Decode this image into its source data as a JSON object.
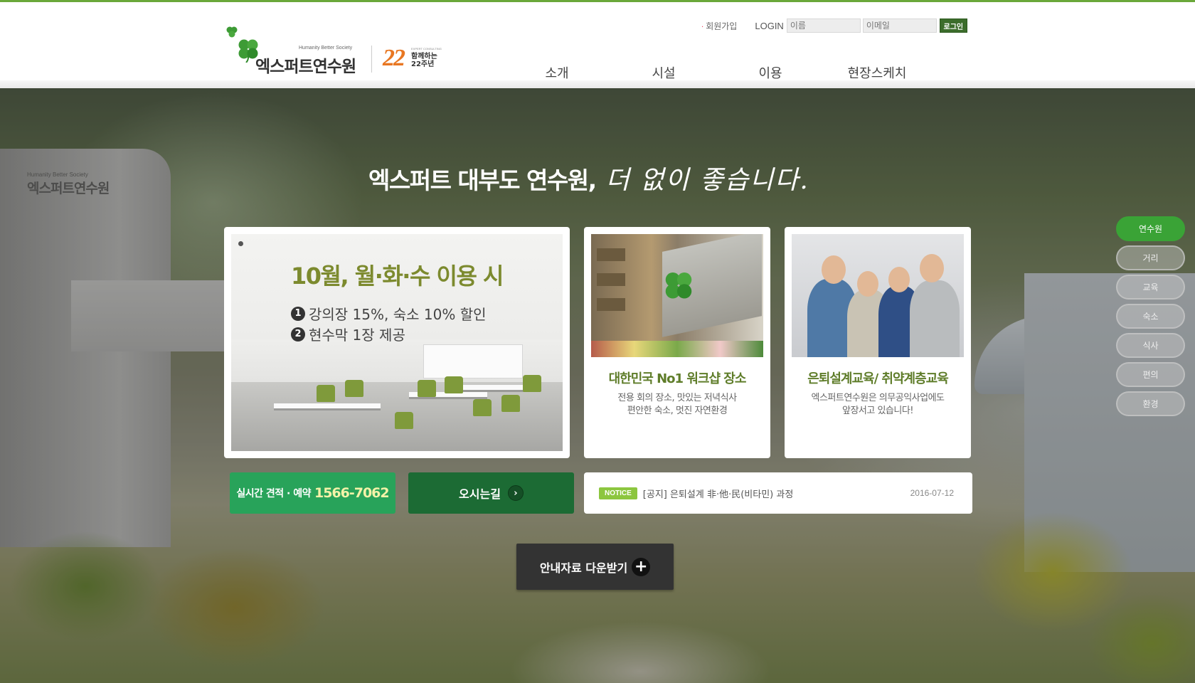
{
  "header": {
    "logo": {
      "tagline": "Humanity Better Society",
      "name": "엑스퍼트연수원",
      "anniversary_number": "22",
      "anniversary_small": "EXPERT CONSULTING",
      "anniversary_line1": "함께하는",
      "anniversary_line2": "22주년"
    },
    "util": {
      "join_label": "회원가입",
      "login_label": "LOGIN",
      "name_placeholder": "이름",
      "email_placeholder": "이메일",
      "login_button": "로그인"
    },
    "nav": [
      "소개",
      "시설",
      "이용",
      "현장스케치"
    ]
  },
  "hero": {
    "building_sign_small": "Humanity Better Society",
    "building_sign": "엑스퍼트연수원",
    "slogan_main": "엑스퍼트 대부도 연수원,",
    "slogan_script": "더 없이 좋습니다."
  },
  "promo": {
    "title": "10월, 월·화·수 이용 시",
    "line1_num": "1",
    "line1": "강의장 15%, 숙소 10% 할인",
    "line2_num": "2",
    "line2": "현수막 1장 제공"
  },
  "cards": [
    {
      "title": "대한민국 No1 워크샵 장소",
      "desc_line1": "전용 회의 장소, 맛있는 저녁식사",
      "desc_line2": "편안한 숙소, 멋진 자연환경"
    },
    {
      "title": "은퇴설계교육/ 취약계층교육",
      "desc_line1": "엑스퍼트연수원은 의무공익사업에도",
      "desc_line2": "앞장서고 있습니다!"
    }
  ],
  "actions": {
    "call_label": "실시간 견적 · 예약",
    "call_phone": "1566-7062",
    "map_label": "오시는길",
    "map_arrow": "›",
    "download_label": "안내자료 다운받기",
    "download_plus": "+"
  },
  "notice": {
    "badge": "NOTICE",
    "text": "[공지] 은퇴설계 非·他·民(비타민) 과정",
    "date": "2016-07-12"
  },
  "quick_nav": {
    "items": [
      "연수원",
      "거리",
      "교육",
      "숙소",
      "식사",
      "편의",
      "환경"
    ],
    "active_index": 0
  },
  "colors": {
    "brand_green": "#6aa83a",
    "dark_green": "#1c6b34",
    "call_green": "#28a35a",
    "promo_title": "#7c8a2e"
  }
}
